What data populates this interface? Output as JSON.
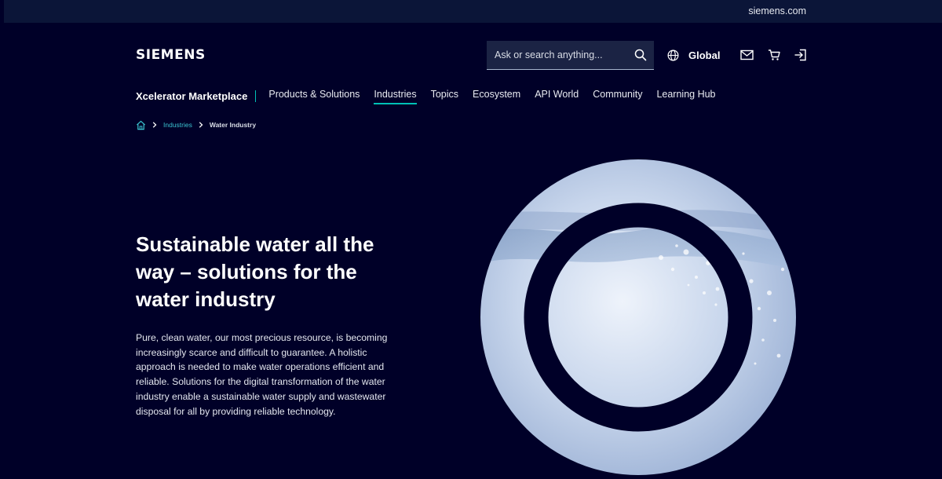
{
  "topbar": {
    "link_label": "siemens.com"
  },
  "header": {
    "logo_text": "SIEMENS",
    "search": {
      "placeholder": "Ask or search anything..."
    },
    "region_label": "Global",
    "icons": [
      "globe-icon",
      "mail-icon",
      "cart-icon",
      "login-icon",
      "search-icon"
    ]
  },
  "nav": {
    "brand": "Xcelerator Marketplace",
    "items": [
      {
        "label": "Products & Solutions",
        "active": false
      },
      {
        "label": "Industries",
        "active": true
      },
      {
        "label": "Topics",
        "active": false
      },
      {
        "label": "Ecosystem",
        "active": false
      },
      {
        "label": "API World",
        "active": false
      },
      {
        "label": "Community",
        "active": false
      },
      {
        "label": "Learning Hub",
        "active": false
      }
    ]
  },
  "breadcrumb": {
    "home_icon": "home-icon",
    "items": [
      "Industries",
      "Water Industry"
    ]
  },
  "hero": {
    "title": "Sustainable water all the way – solutions for the water industry",
    "description": "Pure, clean water, our most precious resource, is becoming increasingly scarce and difficult to guarantee. A holistic approach is needed to make water operations efficient and reliable. Solutions for the digital transformation of the water industry enable a sustainable water supply and wastewater disposal for all by providing reliable technology."
  },
  "colors": {
    "background": "#000028",
    "topbar": "#0b1538",
    "accent": "#00c1b6",
    "link": "#3ac2cf",
    "search_bg": "#1b2344"
  }
}
